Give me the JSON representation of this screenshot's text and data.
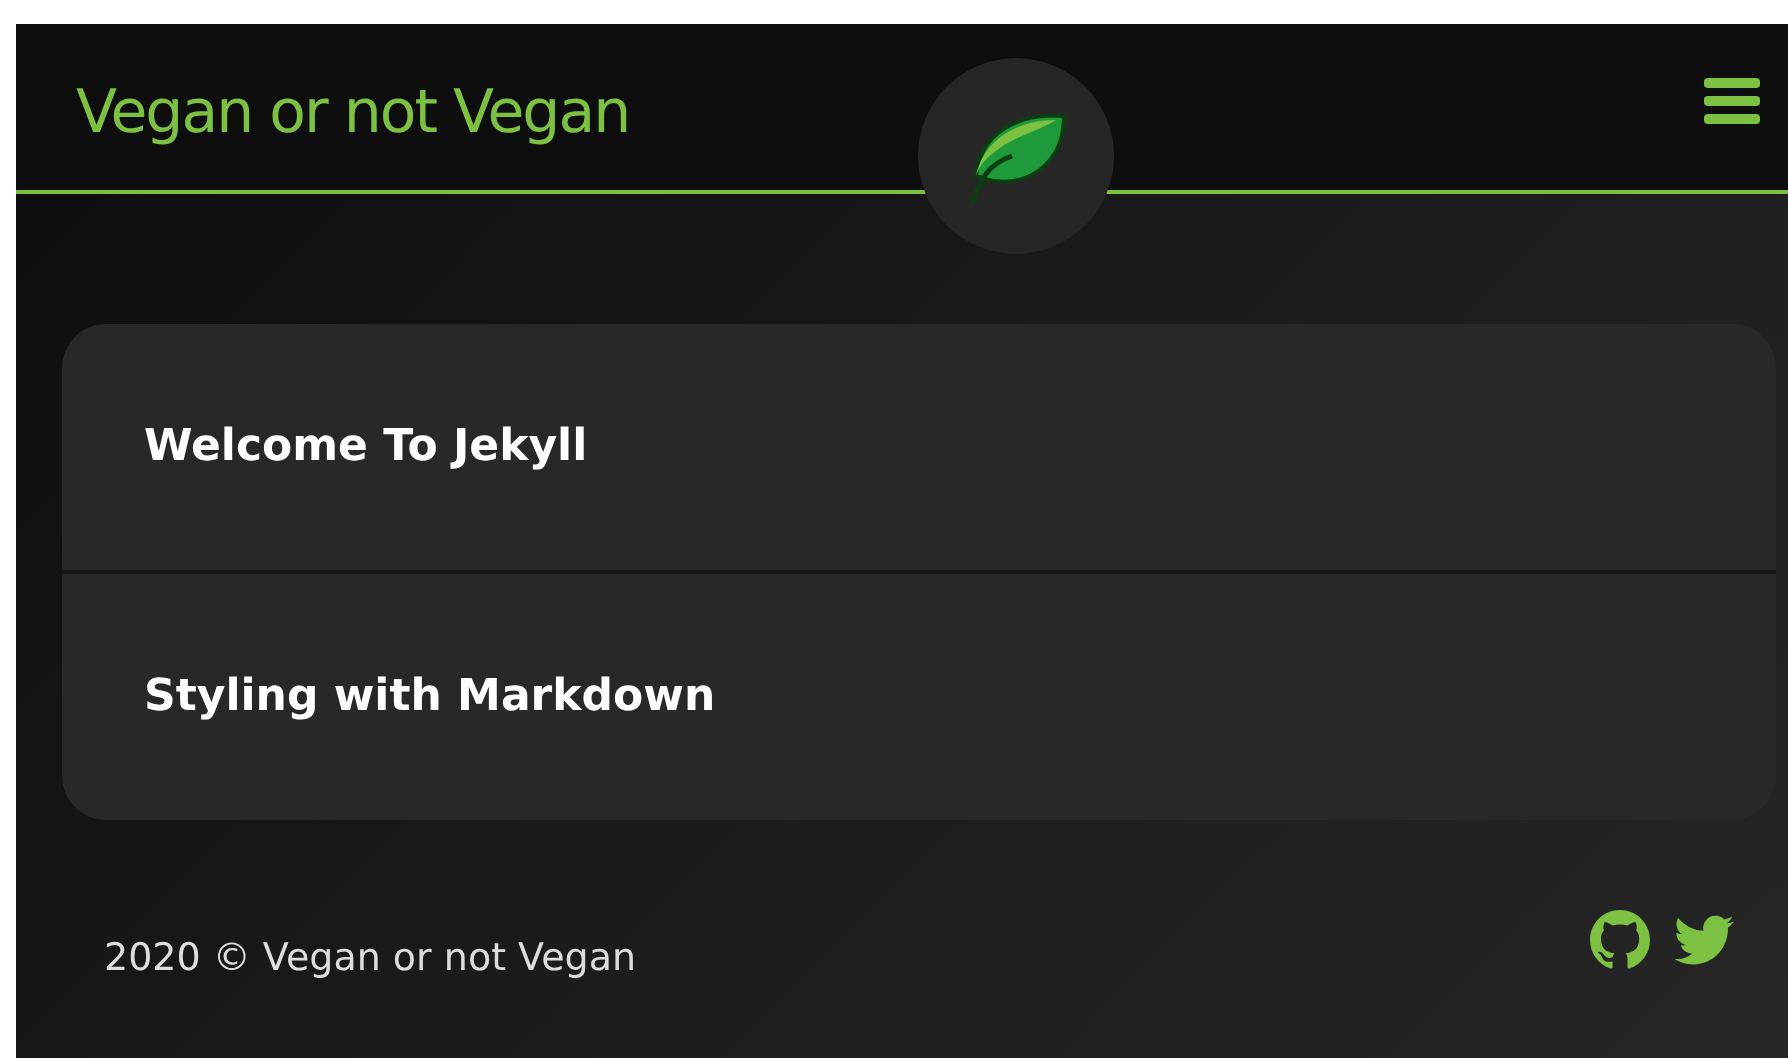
{
  "header": {
    "title": "Vegan or not Vegan"
  },
  "posts": [
    {
      "title": "Welcome To Jekyll"
    },
    {
      "title": "Styling with Markdown"
    }
  ],
  "footer": {
    "copyright": "2020 © Vegan or not Vegan"
  }
}
